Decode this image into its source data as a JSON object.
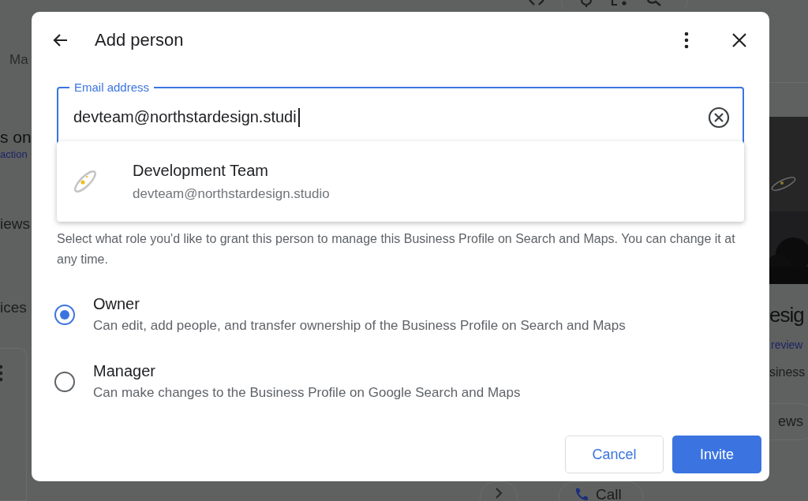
{
  "background": {
    "left": [
      {
        "kind": "tab",
        "text": "Ma"
      },
      {
        "kind": "heading",
        "text": "s on"
      },
      {
        "kind": "link",
        "text": "action"
      },
      {
        "kind": "text",
        "text": "iews"
      },
      {
        "kind": "text",
        "text": "ices"
      }
    ],
    "right": [
      {
        "kind": "heading",
        "text": "esig"
      },
      {
        "kind": "link",
        "text": "review"
      },
      {
        "kind": "text",
        "text": "siness"
      },
      {
        "kind": "chip",
        "text": "ews"
      }
    ],
    "call_chip": "Call"
  },
  "dialog": {
    "title": "Add person",
    "email_field": {
      "label": "Email address",
      "value": "devteam@northstardesign.studi"
    },
    "suggestion": {
      "name": "Development Team",
      "email": "devteam@northstardesign.studio"
    },
    "description": "Select what role you'd like to grant this person to manage this Business Profile on Search and Maps. You can change it at any time.",
    "roles": [
      {
        "label": "Owner",
        "description": "Can edit, add people, and transfer ownership of the Business Profile on Search and Maps",
        "selected": true
      },
      {
        "label": "Manager",
        "description": "Can make changes to the Business Profile on Google Search and Maps",
        "selected": false
      }
    ],
    "buttons": [
      {
        "label": "Cancel",
        "kind": "secondary"
      },
      {
        "label": "Invite",
        "kind": "primary"
      }
    ]
  }
}
